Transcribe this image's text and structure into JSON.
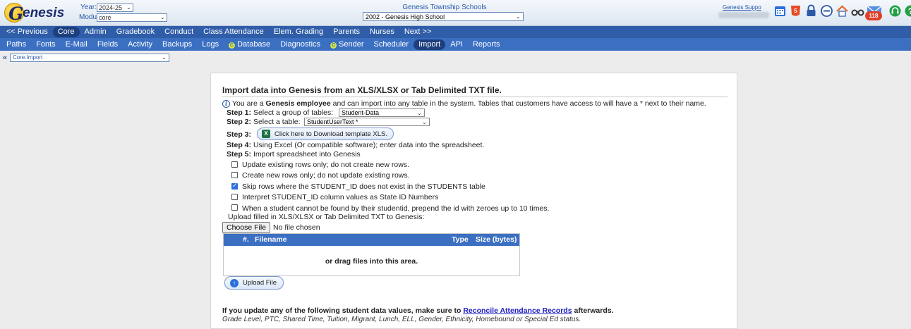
{
  "header": {
    "logo_text": "enesis",
    "year_label": "Year:",
    "year_value": "2024-25",
    "module_label": "Module:",
    "module_value": "core",
    "district": "Genesis Township Schools",
    "school": "2002 - Genesis High School",
    "user": "Genesis Suppo",
    "notification_count": "118"
  },
  "nav_main": [
    "<< Previous",
    "Core",
    "Admin",
    "Gradebook",
    "Conduct",
    "Class Attendance",
    "Elem. Grading",
    "Parents",
    "Nurses",
    "Next >>"
  ],
  "nav_sub": [
    "Paths",
    "Fonts",
    "E-Mail",
    "Fields",
    "Activity",
    "Backups",
    "Logs",
    "Database",
    "Diagnostics",
    "Sender",
    "Scheduler",
    "Import",
    "API",
    "Reports"
  ],
  "breadcrumb": {
    "value": "Core.Import"
  },
  "panel": {
    "title": "Import data into Genesis from an XLS/XLSX or Tab Delimited TXT file.",
    "intro_pre": "You are a ",
    "intro_bold": "Genesis employee",
    "intro_post": " and can import into any table in the system. Tables that customers have access to will have a * next to their name.",
    "step1_label": "Step 1:",
    "step1_text": "Select a group of tables:",
    "step1_value": "Student-Data",
    "step2_label": "Step 2:",
    "step2_text": "Select a table:",
    "step2_value": "StudentUserText *",
    "step3_label": "Step 3:",
    "step3_button": "Click here to Download template XLS.",
    "step4_label": "Step 4:",
    "step4_text": "Using Excel (Or compatible software); enter data into the spreadsheet.",
    "step5_label": "Step 5:",
    "step5_text": "Import spreadsheet into Genesis",
    "options": [
      {
        "label": "Update existing rows only; do not create new rows.",
        "checked": false
      },
      {
        "label": "Create new rows only; do not update existing rows.",
        "checked": false
      },
      {
        "label": "Skip rows where the STUDENT_ID does not exist in the STUDENTS table",
        "checked": true
      },
      {
        "label": "Interpret STUDENT_ID column values as State ID Numbers",
        "checked": false
      },
      {
        "label": "When a student cannot be found by their studentid, prepend the id with zeroes up to 10 times.",
        "checked": false
      }
    ],
    "upload_label": "Upload filled in XLS/XLSX or Tab Delimited TXT to Genesis:",
    "choose_file": "Choose File",
    "no_file": "No file chosen",
    "table_headers": {
      "num": "#.",
      "filename": "Filename",
      "type": "Type",
      "size": "Size (bytes)"
    },
    "drop_text": "or drag files into this area.",
    "upload_button": "Upload File",
    "notice_pre": "If you update any of the following student data values, make sure to ",
    "notice_link": "Reconcile Attendance Records",
    "notice_post": " afterwards.",
    "notice_fields": "Grade Level, PTC, Shared Time, Tuition, Migrant, Lunch, ELL, Gender, Ethnicity, Homebound or Special Ed status."
  }
}
